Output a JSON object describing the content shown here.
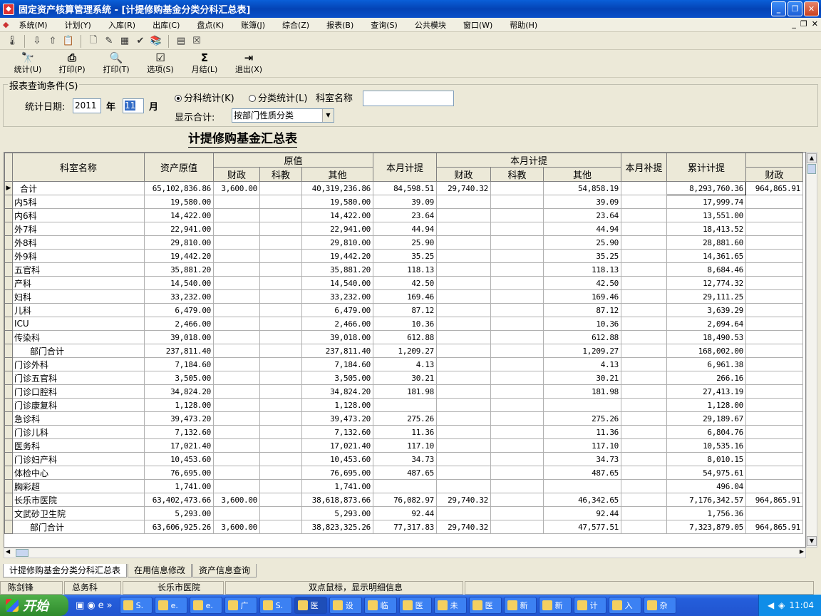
{
  "window": {
    "title": "固定资产核算管理系统 - [计提修购基金分类分科汇总表]"
  },
  "menu": [
    "系统(M)",
    "计划(Y)",
    "入库(R)",
    "出库(C)",
    "盘点(K)",
    "账簿(J)",
    "综合(Z)",
    "报表(B)",
    "查询(S)",
    "公共模块",
    "窗口(W)",
    "帮助(H)"
  ],
  "toolbar_icons": [
    "thermometer-icon",
    "import-icon",
    "export-icon",
    "clipboard-icon",
    "new-doc-icon",
    "stamp-icon",
    "calculator-icon",
    "checkmark-doc-icon",
    "books-icon",
    "grid-icon",
    "cross-box-icon"
  ],
  "buttons": [
    {
      "name": "stats-button",
      "icon": "binoculars-icon",
      "glyph": "🔭",
      "label": "统计(U)"
    },
    {
      "name": "print-button",
      "icon": "printer-icon",
      "glyph": "⎙",
      "label": "打印(P)"
    },
    {
      "name": "print-preview-button",
      "icon": "print-preview-icon",
      "glyph": "🔍",
      "label": "打印(T)"
    },
    {
      "name": "options-button",
      "icon": "options-icon",
      "glyph": "☑",
      "label": "选项(S)"
    },
    {
      "name": "month-close-button",
      "icon": "sigma-icon",
      "glyph": "Σ",
      "label": "月结(L)"
    },
    {
      "name": "exit-button",
      "icon": "exit-door-icon",
      "glyph": "⇥",
      "label": "退出(X)"
    }
  ],
  "query": {
    "legend": "报表查询条件(S)",
    "date_label": "统计日期:",
    "year": "2011",
    "year_label": "年",
    "month": "11",
    "month_label": "月",
    "radio_dept": "分科统计(K)",
    "radio_class": "分类统计(L)",
    "dept_name_label": "科室名称",
    "dept_name_value": "",
    "show_total_label": "显示合计:",
    "show_total_value": "按部门性质分类"
  },
  "report_title": "计提修购基金汇总表",
  "headers": {
    "dept": "科室名称",
    "asset": "资产原值",
    "orig": "原值",
    "month_accr": "本月计提",
    "month_accr2": "本月计提",
    "month_supp": "本月补提",
    "cum": "累计计提",
    "fin": "财政",
    "edu": "科教",
    "other": "其他"
  },
  "rows": [
    {
      "name": "合计",
      "indent": 1,
      "asset": "65,102,836.86",
      "fin": "3,600.00",
      "edu": "",
      "oth": "40,319,236.86",
      "mon": "84,598.51",
      "mfin": "29,740.32",
      "medu": "",
      "moth": "54,858.19",
      "supp": "",
      "cum": "8,293,760.36",
      "cfin": "964,865.91",
      "current": true
    },
    {
      "name": "内5科",
      "indent": 0,
      "asset": "19,580.00",
      "fin": "",
      "edu": "",
      "oth": "19,580.00",
      "mon": "39.09",
      "mfin": "",
      "medu": "",
      "moth": "39.09",
      "supp": "",
      "cum": "17,999.74",
      "cfin": ""
    },
    {
      "name": "内6科",
      "indent": 0,
      "asset": "14,422.00",
      "fin": "",
      "edu": "",
      "oth": "14,422.00",
      "mon": "23.64",
      "mfin": "",
      "medu": "",
      "moth": "23.64",
      "supp": "",
      "cum": "13,551.00",
      "cfin": ""
    },
    {
      "name": "外7科",
      "indent": 0,
      "asset": "22,941.00",
      "fin": "",
      "edu": "",
      "oth": "22,941.00",
      "mon": "44.94",
      "mfin": "",
      "medu": "",
      "moth": "44.94",
      "supp": "",
      "cum": "18,413.52",
      "cfin": ""
    },
    {
      "name": "外8科",
      "indent": 0,
      "asset": "29,810.00",
      "fin": "",
      "edu": "",
      "oth": "29,810.00",
      "mon": "25.90",
      "mfin": "",
      "medu": "",
      "moth": "25.90",
      "supp": "",
      "cum": "28,881.60",
      "cfin": ""
    },
    {
      "name": "外9科",
      "indent": 0,
      "asset": "19,442.20",
      "fin": "",
      "edu": "",
      "oth": "19,442.20",
      "mon": "35.25",
      "mfin": "",
      "medu": "",
      "moth": "35.25",
      "supp": "",
      "cum": "14,361.65",
      "cfin": ""
    },
    {
      "name": "五官科",
      "indent": 0,
      "asset": "35,881.20",
      "fin": "",
      "edu": "",
      "oth": "35,881.20",
      "mon": "118.13",
      "mfin": "",
      "medu": "",
      "moth": "118.13",
      "supp": "",
      "cum": "8,684.46",
      "cfin": ""
    },
    {
      "name": "产科",
      "indent": 0,
      "asset": "14,540.00",
      "fin": "",
      "edu": "",
      "oth": "14,540.00",
      "mon": "42.50",
      "mfin": "",
      "medu": "",
      "moth": "42.50",
      "supp": "",
      "cum": "12,774.32",
      "cfin": ""
    },
    {
      "name": "妇科",
      "indent": 0,
      "asset": "33,232.00",
      "fin": "",
      "edu": "",
      "oth": "33,232.00",
      "mon": "169.46",
      "mfin": "",
      "medu": "",
      "moth": "169.46",
      "supp": "",
      "cum": "29,111.25",
      "cfin": ""
    },
    {
      "name": "儿科",
      "indent": 0,
      "asset": "6,479.00",
      "fin": "",
      "edu": "",
      "oth": "6,479.00",
      "mon": "87.12",
      "mfin": "",
      "medu": "",
      "moth": "87.12",
      "supp": "",
      "cum": "3,639.29",
      "cfin": ""
    },
    {
      "name": "ICU",
      "indent": 0,
      "asset": "2,466.00",
      "fin": "",
      "edu": "",
      "oth": "2,466.00",
      "mon": "10.36",
      "mfin": "",
      "medu": "",
      "moth": "10.36",
      "supp": "",
      "cum": "2,094.64",
      "cfin": ""
    },
    {
      "name": "传染科",
      "indent": 0,
      "asset": "39,018.00",
      "fin": "",
      "edu": "",
      "oth": "39,018.00",
      "mon": "612.88",
      "mfin": "",
      "medu": "",
      "moth": "612.88",
      "supp": "",
      "cum": "18,490.53",
      "cfin": ""
    },
    {
      "name": "部门合计",
      "indent": 2,
      "asset": "237,811.40",
      "fin": "",
      "edu": "",
      "oth": "237,811.40",
      "mon": "1,209.27",
      "mfin": "",
      "medu": "",
      "moth": "1,209.27",
      "supp": "",
      "cum": "168,002.00",
      "cfin": ""
    },
    {
      "name": "门诊外科",
      "indent": 0,
      "asset": "7,184.60",
      "fin": "",
      "edu": "",
      "oth": "7,184.60",
      "mon": "4.13",
      "mfin": "",
      "medu": "",
      "moth": "4.13",
      "supp": "",
      "cum": "6,961.38",
      "cfin": ""
    },
    {
      "name": "门诊五官科",
      "indent": 0,
      "asset": "3,505.00",
      "fin": "",
      "edu": "",
      "oth": "3,505.00",
      "mon": "30.21",
      "mfin": "",
      "medu": "",
      "moth": "30.21",
      "supp": "",
      "cum": "266.16",
      "cfin": ""
    },
    {
      "name": "门诊口腔科",
      "indent": 0,
      "asset": "34,824.20",
      "fin": "",
      "edu": "",
      "oth": "34,824.20",
      "mon": "181.98",
      "mfin": "",
      "medu": "",
      "moth": "181.98",
      "supp": "",
      "cum": "27,413.19",
      "cfin": ""
    },
    {
      "name": "门诊康复科",
      "indent": 0,
      "asset": "1,128.00",
      "fin": "",
      "edu": "",
      "oth": "1,128.00",
      "mon": "",
      "mfin": "",
      "medu": "",
      "moth": "",
      "supp": "",
      "cum": "1,128.00",
      "cfin": ""
    },
    {
      "name": "急诊科",
      "indent": 0,
      "asset": "39,473.20",
      "fin": "",
      "edu": "",
      "oth": "39,473.20",
      "mon": "275.26",
      "mfin": "",
      "medu": "",
      "moth": "275.26",
      "supp": "",
      "cum": "29,189.67",
      "cfin": ""
    },
    {
      "name": "门诊儿科",
      "indent": 0,
      "asset": "7,132.60",
      "fin": "",
      "edu": "",
      "oth": "7,132.60",
      "mon": "11.36",
      "mfin": "",
      "medu": "",
      "moth": "11.36",
      "supp": "",
      "cum": "6,804.76",
      "cfin": ""
    },
    {
      "name": "医务科",
      "indent": 0,
      "asset": "17,021.40",
      "fin": "",
      "edu": "",
      "oth": "17,021.40",
      "mon": "117.10",
      "mfin": "",
      "medu": "",
      "moth": "117.10",
      "supp": "",
      "cum": "10,535.16",
      "cfin": ""
    },
    {
      "name": "门诊妇产科",
      "indent": 0,
      "asset": "10,453.60",
      "fin": "",
      "edu": "",
      "oth": "10,453.60",
      "mon": "34.73",
      "mfin": "",
      "medu": "",
      "moth": "34.73",
      "supp": "",
      "cum": "8,010.15",
      "cfin": ""
    },
    {
      "name": "体检中心",
      "indent": 0,
      "asset": "76,695.00",
      "fin": "",
      "edu": "",
      "oth": "76,695.00",
      "mon": "487.65",
      "mfin": "",
      "medu": "",
      "moth": "487.65",
      "supp": "",
      "cum": "54,975.61",
      "cfin": ""
    },
    {
      "name": "胸彩超",
      "indent": 0,
      "asset": "1,741.00",
      "fin": "",
      "edu": "",
      "oth": "1,741.00",
      "mon": "",
      "mfin": "",
      "medu": "",
      "moth": "",
      "supp": "",
      "cum": "496.04",
      "cfin": ""
    },
    {
      "name": "长乐市医院",
      "indent": 0,
      "asset": "63,402,473.66",
      "fin": "3,600.00",
      "edu": "",
      "oth": "38,618,873.66",
      "mon": "76,082.97",
      "mfin": "29,740.32",
      "medu": "",
      "moth": "46,342.65",
      "supp": "",
      "cum": "7,176,342.57",
      "cfin": "964,865.91"
    },
    {
      "name": "文武砂卫生院",
      "indent": 0,
      "asset": "5,293.00",
      "fin": "",
      "edu": "",
      "oth": "5,293.00",
      "mon": "92.44",
      "mfin": "",
      "medu": "",
      "moth": "92.44",
      "supp": "",
      "cum": "1,756.36",
      "cfin": ""
    },
    {
      "name": "部门合计",
      "indent": 2,
      "asset": "63,606,925.26",
      "fin": "3,600.00",
      "edu": "",
      "oth": "38,823,325.26",
      "mon": "77,317.83",
      "mfin": "29,740.32",
      "medu": "",
      "moth": "47,577.51",
      "supp": "",
      "cum": "7,323,879.05",
      "cfin": "964,865.91"
    }
  ],
  "tabs": [
    "计提修购基金分类分科汇总表",
    "在用信息修改",
    "资产信息查询"
  ],
  "status": [
    "陈剑锋",
    "总务科",
    "长乐市医院",
    "双点鼠标，显示明细信息",
    ""
  ],
  "taskbar": {
    "start": "开始",
    "items": [
      "S.",
      "e.",
      "e.",
      "广",
      "S.",
      "医",
      "设",
      "临",
      "医",
      "未",
      "医",
      "新",
      "新",
      "计",
      "入",
      "杂"
    ],
    "clock": "11:04"
  }
}
